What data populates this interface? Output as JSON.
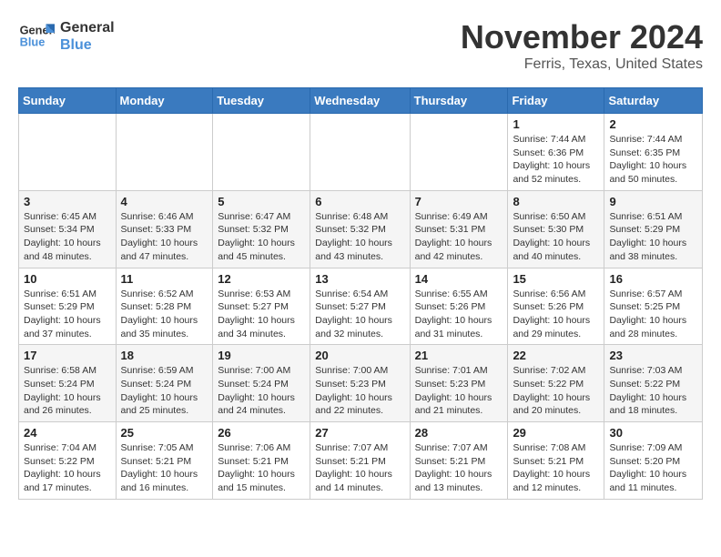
{
  "logo": {
    "line1": "General",
    "line2": "Blue"
  },
  "title": "November 2024",
  "location": "Ferris, Texas, United States",
  "days_of_week": [
    "Sunday",
    "Monday",
    "Tuesday",
    "Wednesday",
    "Thursday",
    "Friday",
    "Saturday"
  ],
  "weeks": [
    [
      {
        "day": "",
        "info": ""
      },
      {
        "day": "",
        "info": ""
      },
      {
        "day": "",
        "info": ""
      },
      {
        "day": "",
        "info": ""
      },
      {
        "day": "",
        "info": ""
      },
      {
        "day": "1",
        "info": "Sunrise: 7:44 AM\nSunset: 6:36 PM\nDaylight: 10 hours\nand 52 minutes."
      },
      {
        "day": "2",
        "info": "Sunrise: 7:44 AM\nSunset: 6:35 PM\nDaylight: 10 hours\nand 50 minutes."
      }
    ],
    [
      {
        "day": "3",
        "info": "Sunrise: 6:45 AM\nSunset: 5:34 PM\nDaylight: 10 hours\nand 48 minutes."
      },
      {
        "day": "4",
        "info": "Sunrise: 6:46 AM\nSunset: 5:33 PM\nDaylight: 10 hours\nand 47 minutes."
      },
      {
        "day": "5",
        "info": "Sunrise: 6:47 AM\nSunset: 5:32 PM\nDaylight: 10 hours\nand 45 minutes."
      },
      {
        "day": "6",
        "info": "Sunrise: 6:48 AM\nSunset: 5:32 PM\nDaylight: 10 hours\nand 43 minutes."
      },
      {
        "day": "7",
        "info": "Sunrise: 6:49 AM\nSunset: 5:31 PM\nDaylight: 10 hours\nand 42 minutes."
      },
      {
        "day": "8",
        "info": "Sunrise: 6:50 AM\nSunset: 5:30 PM\nDaylight: 10 hours\nand 40 minutes."
      },
      {
        "day": "9",
        "info": "Sunrise: 6:51 AM\nSunset: 5:29 PM\nDaylight: 10 hours\nand 38 minutes."
      }
    ],
    [
      {
        "day": "10",
        "info": "Sunrise: 6:51 AM\nSunset: 5:29 PM\nDaylight: 10 hours\nand 37 minutes."
      },
      {
        "day": "11",
        "info": "Sunrise: 6:52 AM\nSunset: 5:28 PM\nDaylight: 10 hours\nand 35 minutes."
      },
      {
        "day": "12",
        "info": "Sunrise: 6:53 AM\nSunset: 5:27 PM\nDaylight: 10 hours\nand 34 minutes."
      },
      {
        "day": "13",
        "info": "Sunrise: 6:54 AM\nSunset: 5:27 PM\nDaylight: 10 hours\nand 32 minutes."
      },
      {
        "day": "14",
        "info": "Sunrise: 6:55 AM\nSunset: 5:26 PM\nDaylight: 10 hours\nand 31 minutes."
      },
      {
        "day": "15",
        "info": "Sunrise: 6:56 AM\nSunset: 5:26 PM\nDaylight: 10 hours\nand 29 minutes."
      },
      {
        "day": "16",
        "info": "Sunrise: 6:57 AM\nSunset: 5:25 PM\nDaylight: 10 hours\nand 28 minutes."
      }
    ],
    [
      {
        "day": "17",
        "info": "Sunrise: 6:58 AM\nSunset: 5:24 PM\nDaylight: 10 hours\nand 26 minutes."
      },
      {
        "day": "18",
        "info": "Sunrise: 6:59 AM\nSunset: 5:24 PM\nDaylight: 10 hours\nand 25 minutes."
      },
      {
        "day": "19",
        "info": "Sunrise: 7:00 AM\nSunset: 5:24 PM\nDaylight: 10 hours\nand 24 minutes."
      },
      {
        "day": "20",
        "info": "Sunrise: 7:00 AM\nSunset: 5:23 PM\nDaylight: 10 hours\nand 22 minutes."
      },
      {
        "day": "21",
        "info": "Sunrise: 7:01 AM\nSunset: 5:23 PM\nDaylight: 10 hours\nand 21 minutes."
      },
      {
        "day": "22",
        "info": "Sunrise: 7:02 AM\nSunset: 5:22 PM\nDaylight: 10 hours\nand 20 minutes."
      },
      {
        "day": "23",
        "info": "Sunrise: 7:03 AM\nSunset: 5:22 PM\nDaylight: 10 hours\nand 18 minutes."
      }
    ],
    [
      {
        "day": "24",
        "info": "Sunrise: 7:04 AM\nSunset: 5:22 PM\nDaylight: 10 hours\nand 17 minutes."
      },
      {
        "day": "25",
        "info": "Sunrise: 7:05 AM\nSunset: 5:21 PM\nDaylight: 10 hours\nand 16 minutes."
      },
      {
        "day": "26",
        "info": "Sunrise: 7:06 AM\nSunset: 5:21 PM\nDaylight: 10 hours\nand 15 minutes."
      },
      {
        "day": "27",
        "info": "Sunrise: 7:07 AM\nSunset: 5:21 PM\nDaylight: 10 hours\nand 14 minutes."
      },
      {
        "day": "28",
        "info": "Sunrise: 7:07 AM\nSunset: 5:21 PM\nDaylight: 10 hours\nand 13 minutes."
      },
      {
        "day": "29",
        "info": "Sunrise: 7:08 AM\nSunset: 5:21 PM\nDaylight: 10 hours\nand 12 minutes."
      },
      {
        "day": "30",
        "info": "Sunrise: 7:09 AM\nSunset: 5:20 PM\nDaylight: 10 hours\nand 11 minutes."
      }
    ]
  ]
}
